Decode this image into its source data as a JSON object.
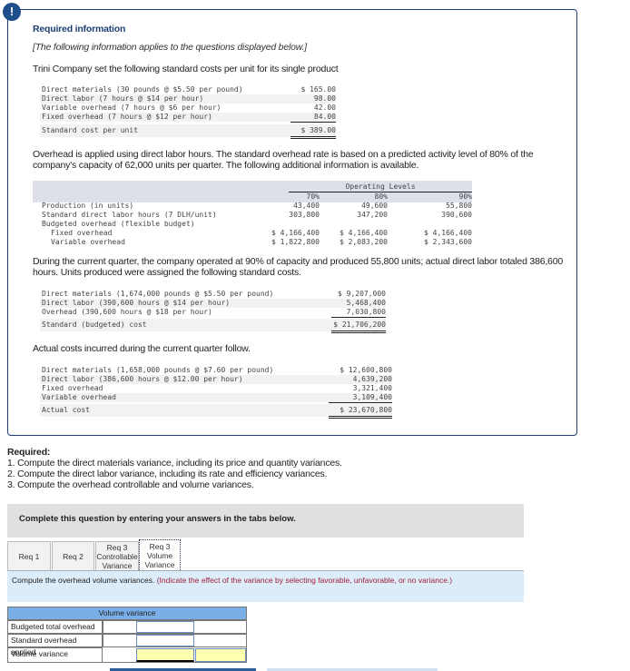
{
  "header": {
    "title": "Required information",
    "note": "[The following information applies to the questions displayed below.]",
    "intro": "Trini Company set the following standard costs per unit for its single product"
  },
  "std_costs": {
    "rows": [
      {
        "label": "Direct materials (30 pounds @ $5.50 per pound)",
        "value": "$ 165.00"
      },
      {
        "label": "Direct labor (7 hours @ $14 per hour)",
        "value": "98.00"
      },
      {
        "label": "Variable overhead (7 hours @ $6 per hour)",
        "value": "42.00"
      },
      {
        "label": "Fixed overhead (7 hours @ $12 per hour)",
        "value": "84.00"
      }
    ],
    "total_label": "Standard cost per unit",
    "total_value": "$ 389.00"
  },
  "overhead_para": "Overhead is applied using direct labor hours. The standard overhead rate is based on a predicted activity level of 80% of the company's capacity of 62,000 units per quarter. The following additional information is available.",
  "flex": {
    "group_header": "Operating Levels",
    "levels": [
      "70%",
      "80%",
      "90%"
    ],
    "rows": [
      {
        "label": "Production (in units)",
        "values": [
          "43,400",
          "49,600",
          "55,800"
        ]
      },
      {
        "label": "Standard direct labor hours (7 DLH/unit)",
        "values": [
          "303,800",
          "347,200",
          "390,600"
        ]
      },
      {
        "label": "Budgeted overhead (flexible budget)",
        "values": [
          "",
          "",
          ""
        ]
      },
      {
        "label": "Fixed overhead",
        "values": [
          "$ 4,166,400",
          "$ 4,166,400",
          "$ 4,166,400"
        ]
      },
      {
        "label": "Variable overhead",
        "values": [
          "$ 1,822,800",
          "$ 2,083,200",
          "$ 2,343,600"
        ]
      }
    ]
  },
  "quarter_para": "During the current quarter, the company operated at 90% of capacity and produced 55,800 units; actual direct labor totaled 386,600 hours. Units produced were assigned the following standard costs.",
  "assigned": {
    "rows": [
      {
        "label": "Direct materials (1,674,000 pounds @ $5.50 per pound)",
        "value": "$ 9,207,000"
      },
      {
        "label": "Direct labor (390,600 hours @ $14 per hour)",
        "value": "5,468,400"
      },
      {
        "label": "Overhead (390,600 hours @ $18 per hour)",
        "value": "7,030,800"
      }
    ],
    "total_label": "Standard (budgeted) cost",
    "total_value": "$ 21,706,200"
  },
  "actual_para": "Actual costs incurred during the current quarter follow.",
  "actual": {
    "rows": [
      {
        "label": "Direct materials (1,658,000 pounds @ $7.60 per pound)",
        "value": "$ 12,600,800"
      },
      {
        "label": "Direct labor (386,600 hours @ $12.00 per hour)",
        "value": "4,639,200"
      },
      {
        "label": "Fixed overhead",
        "value": "3,321,400"
      },
      {
        "label": "Variable overhead",
        "value": "3,109,400"
      }
    ],
    "total_label": "Actual cost",
    "total_value": "$ 23,670,800"
  },
  "required": {
    "title": "Required:",
    "items": [
      "1. Compute the direct materials variance, including its price and quantity variances.",
      "2. Compute the direct labor variance, including its rate and efficiency variances.",
      "3. Compute the overhead controllable and volume variances."
    ]
  },
  "complete_banner": "Complete this question by entering your answers in the tabs below.",
  "tabs": [
    "Req 1",
    "Req 2",
    "Req 3 Controllable Variance",
    "Req 3 Volume Variance"
  ],
  "instruction": {
    "main": "Compute the overhead volume variances.",
    "hint": "(Indicate the effect of the variance by selecting favorable, unfavorable, or no variance.)"
  },
  "answer_table": {
    "header": "Volume variance",
    "rows": [
      "Budgeted total overhead",
      "Standard overhead applied",
      "Volume variance"
    ]
  },
  "colors": {
    "accent": "#1f4e8c",
    "hint": "#a0203a",
    "header_blue": "#7aaee6",
    "input_yellow": "#ffffb0"
  }
}
